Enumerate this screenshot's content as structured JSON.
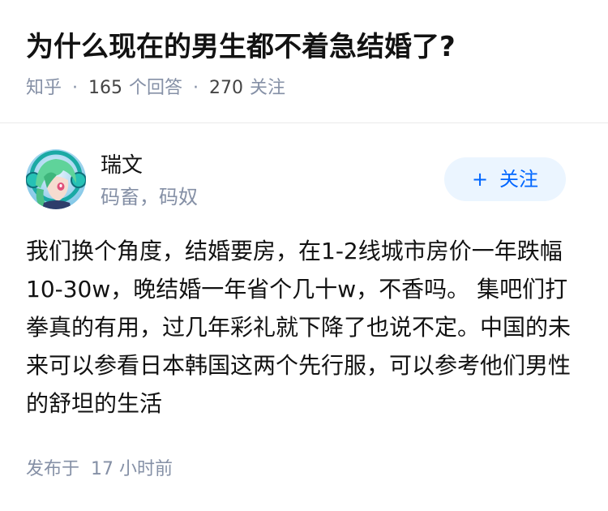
{
  "question": {
    "title": "为什么现在的男生都不着急结婚了?",
    "source": "知乎",
    "answer_count": "165",
    "answer_label": "个回答",
    "follower_count": "270",
    "follower_label": "关注"
  },
  "author": {
    "name": "瑞文",
    "bio": "码畜，码奴",
    "avatar_icon": "anime-character-avatar",
    "follow_plus": "+",
    "follow_label": "关注"
  },
  "answer": {
    "content": "我们换个角度，结婚要房，在1-2线城市房价一年跌幅10-30w，晚结婚一年省个几十w，不香吗。 集吧们打拳真的有用，过几年彩礼就下降了也说不定。中国的未来可以参看日本韩国这两个先行服，可以参考他们男性的舒坦的生活",
    "published": "发布于  17 小时前"
  },
  "colors": {
    "accent": "#0066ff",
    "follow_bg": "#ebf5ff",
    "meta_text": "#8590a6"
  }
}
